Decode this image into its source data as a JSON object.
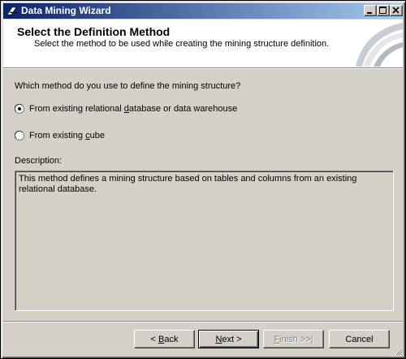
{
  "window": {
    "title": "Data Mining Wizard",
    "icon": "wizard-icon"
  },
  "header": {
    "title": "Select the Definition Method",
    "subtitle": "Select the method to be used while creating the mining structure definition."
  },
  "main": {
    "question": "Which method do you use to define the mining structure?",
    "options": [
      {
        "label_before": "From existing relational ",
        "label_accel": "d",
        "label_after": "atabase or data warehouse",
        "selected": true
      },
      {
        "label_before": "From existing ",
        "label_accel": "c",
        "label_after": "ube",
        "selected": false
      }
    ],
    "description_label": "Description:",
    "description_text": "This method defines a mining structure based on tables and columns from an existing relational database."
  },
  "buttons": {
    "back": {
      "prefix": "< ",
      "accel": "B",
      "rest": "ack"
    },
    "next": {
      "accel": "N",
      "rest": "ext >"
    },
    "finish": {
      "accel": "F",
      "rest": "inish >>|",
      "disabled": true
    },
    "cancel": {
      "label": "Cancel"
    }
  },
  "colors": {
    "titlebar_start": "#0a246a",
    "titlebar_end": "#a6caf0",
    "face": "#d4d0c8"
  }
}
